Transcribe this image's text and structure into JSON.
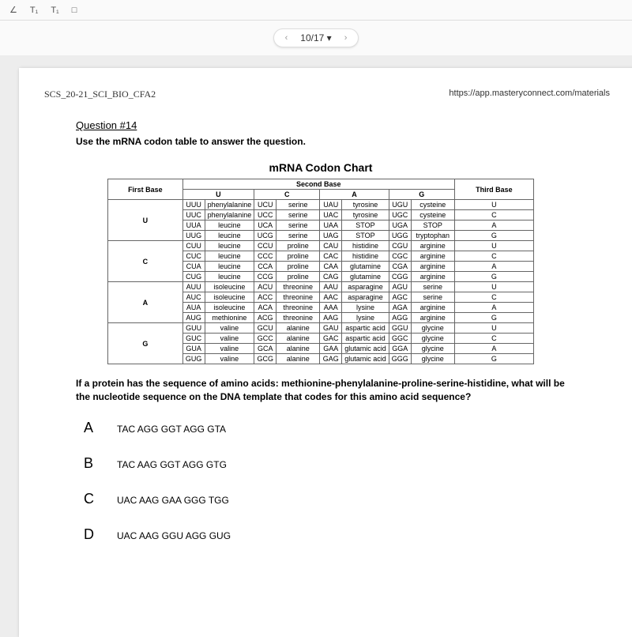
{
  "toolbar": {
    "items": [
      "∠",
      "T₁",
      "T₁",
      "□"
    ]
  },
  "pager": {
    "prev": "‹",
    "label": "10/17 ▾",
    "next": "›"
  },
  "doc_title": "SCS_20-21_SCI_BIO_CFA2",
  "url": "https://app.masteryconnect.com/materials",
  "question_heading": "Question #14",
  "question_instr": "Use the mRNA codon table to answer the question.",
  "chart_title": "mRNA Codon Chart",
  "codon": {
    "first": "First Base",
    "second": "Second Base",
    "third": "Third Base",
    "U": "U",
    "C": "C",
    "A": "A",
    "G": "G"
  },
  "rows": [
    {
      "f": "U",
      "r": [
        [
          "UUU",
          "phenylalanine",
          "UCU",
          "serine",
          "UAU",
          "tyrosine",
          "UGU",
          "cysteine",
          "U"
        ],
        [
          "UUC",
          "phenylalanine",
          "UCC",
          "serine",
          "UAC",
          "tyrosine",
          "UGC",
          "cysteine",
          "C"
        ],
        [
          "UUA",
          "leucine",
          "UCA",
          "serine",
          "UAA",
          "STOP",
          "UGA",
          "STOP",
          "A"
        ],
        [
          "UUG",
          "leucine",
          "UCG",
          "serine",
          "UAG",
          "STOP",
          "UGG",
          "tryptophan",
          "G"
        ]
      ]
    },
    {
      "f": "C",
      "r": [
        [
          "CUU",
          "leucine",
          "CCU",
          "proline",
          "CAU",
          "histidine",
          "CGU",
          "arginine",
          "U"
        ],
        [
          "CUC",
          "leucine",
          "CCC",
          "proline",
          "CAC",
          "histidine",
          "CGC",
          "arginine",
          "C"
        ],
        [
          "CUA",
          "leucine",
          "CCA",
          "proline",
          "CAA",
          "glutamine",
          "CGA",
          "arginine",
          "A"
        ],
        [
          "CUG",
          "leucine",
          "CCG",
          "proline",
          "CAG",
          "glutamine",
          "CGG",
          "arginine",
          "G"
        ]
      ]
    },
    {
      "f": "A",
      "r": [
        [
          "AUU",
          "isoleucine",
          "ACU",
          "threonine",
          "AAU",
          "asparagine",
          "AGU",
          "serine",
          "U"
        ],
        [
          "AUC",
          "isoleucine",
          "ACC",
          "threonine",
          "AAC",
          "asparagine",
          "AGC",
          "serine",
          "C"
        ],
        [
          "AUA",
          "isoleucine",
          "ACA",
          "threonine",
          "AAA",
          "lysine",
          "AGA",
          "arginine",
          "A"
        ],
        [
          "AUG",
          "methionine",
          "ACG",
          "threonine",
          "AAG",
          "lysine",
          "AGG",
          "arginine",
          "G"
        ]
      ]
    },
    {
      "f": "G",
      "r": [
        [
          "GUU",
          "valine",
          "GCU",
          "alanine",
          "GAU",
          "aspartic acid",
          "GGU",
          "glycine",
          "U"
        ],
        [
          "GUC",
          "valine",
          "GCC",
          "alanine",
          "GAC",
          "aspartic acid",
          "GGC",
          "glycine",
          "C"
        ],
        [
          "GUA",
          "valine",
          "GCA",
          "alanine",
          "GAA",
          "glutamic acid",
          "GGA",
          "glycine",
          "A"
        ],
        [
          "GUG",
          "valine",
          "GCG",
          "alanine",
          "GAG",
          "glutamic acid",
          "GGG",
          "glycine",
          "G"
        ]
      ]
    }
  ],
  "question_text": "If a protein has the sequence of amino acids: methionine-phenylalanine-proline-serine-histidine, what will be the nucleotide sequence on the DNA template that codes for this amino acid sequence?",
  "answers": [
    {
      "letter": "A",
      "text": "TAC AGG GGT AGG GTA"
    },
    {
      "letter": "B",
      "text": "TAC AAG GGT AGG GTG"
    },
    {
      "letter": "C",
      "text": "UAC AAG GAA GGG TGG"
    },
    {
      "letter": "D",
      "text": "UAC AAG GGU AGG GUG"
    }
  ]
}
